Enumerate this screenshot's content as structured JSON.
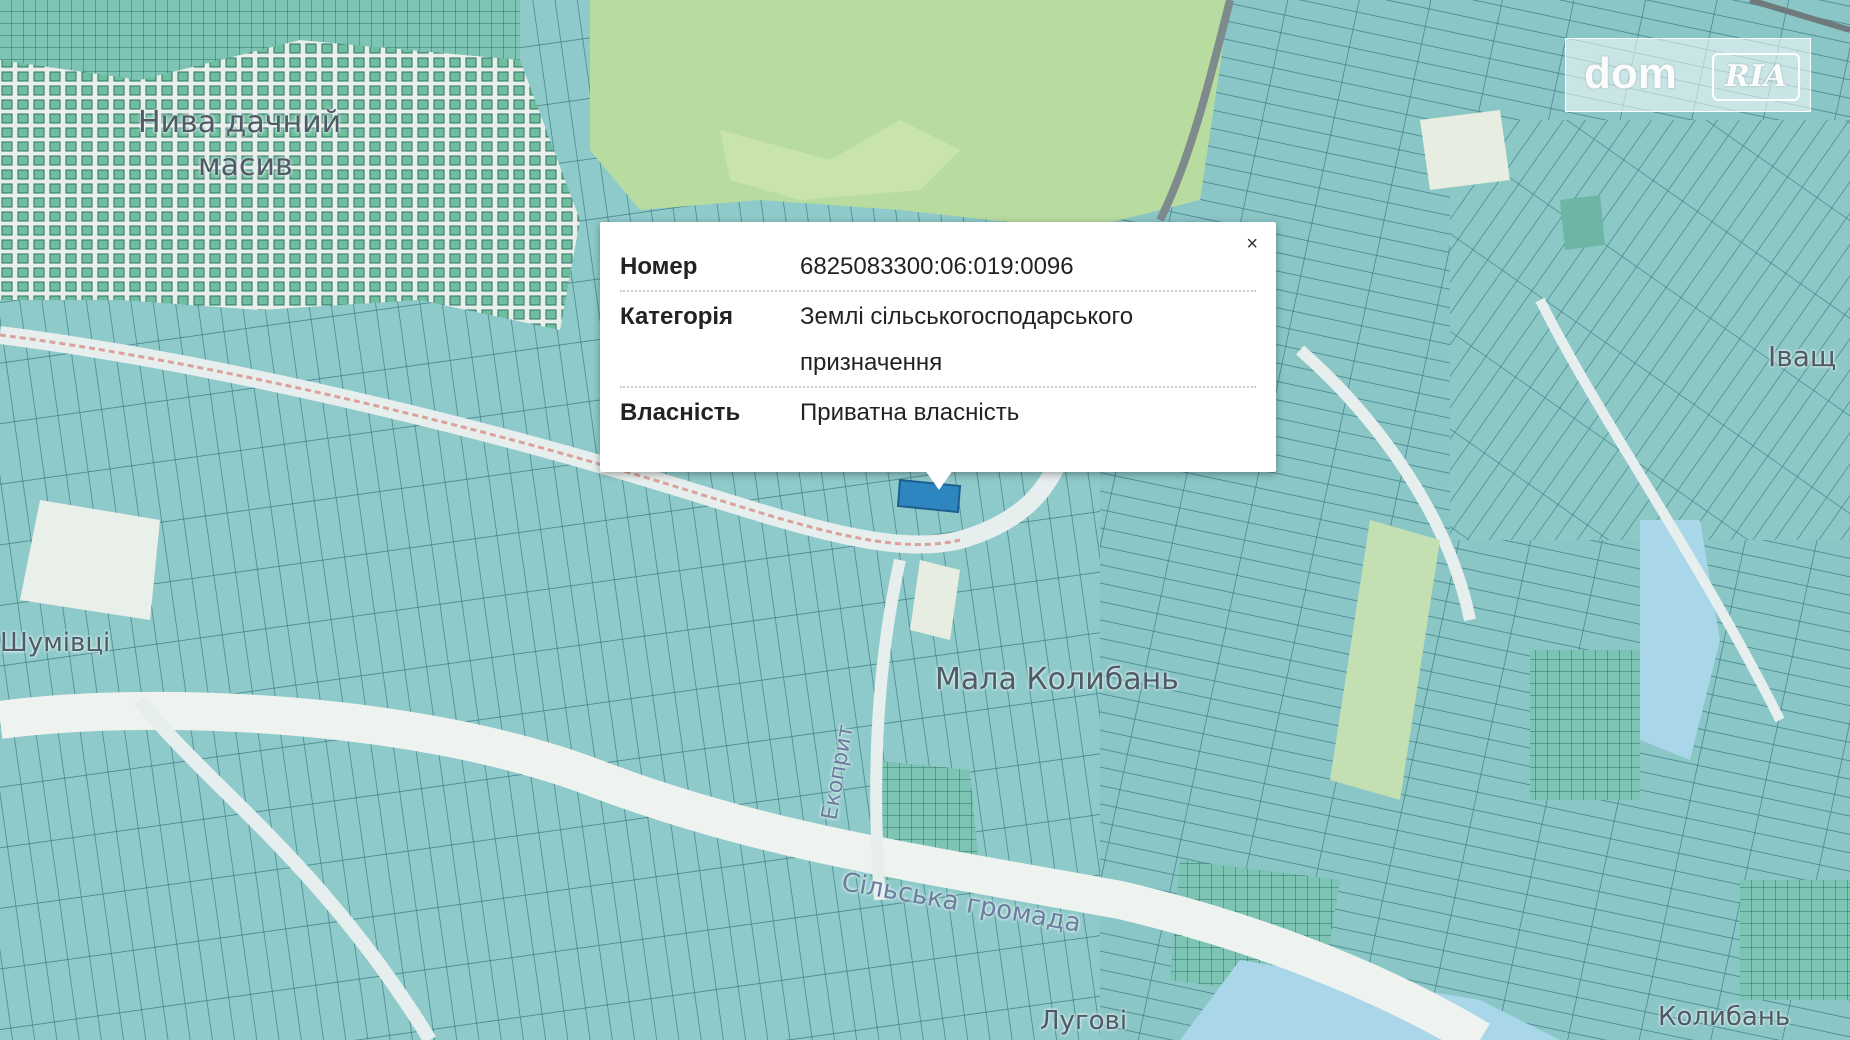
{
  "map": {
    "labels": {
      "niva": "Нива дачний",
      "niva_2": "масив",
      "mala_kolyban": "Мала Колибань",
      "umivtsi": "Шумівці",
      "ivashch": "Іващ",
      "silska_hromada": "Сільська громада",
      "ekopolit": "Екоприт",
      "lugovi": "Лугові",
      "kolyban": "Колибань"
    }
  },
  "popup": {
    "close": "×",
    "rows": [
      {
        "key": "Номер",
        "value": "6825083300:06:019:0096"
      },
      {
        "key": "Категорія",
        "value": "Землі сільськогосподарського",
        "value2": "призначення"
      },
      {
        "key": "Власність",
        "value": "Приватна власність"
      }
    ]
  },
  "watermark": {
    "dom": "dom",
    "ria": "RIA"
  },
  "colors": {
    "parcel": "#89c7c7",
    "parcel_dark": "#5aa3a6",
    "road": "#eef3f0",
    "forest": "#b9dc9e",
    "water": "#a9d6e8",
    "selected": "#2e86c1"
  }
}
